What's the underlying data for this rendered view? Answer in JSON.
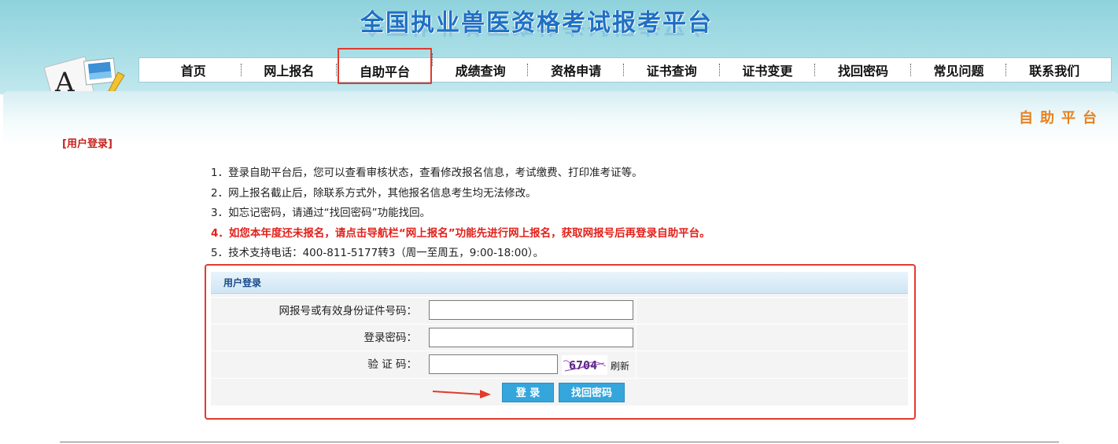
{
  "header": {
    "site_title": "全国执业兽医资格考试报考平台"
  },
  "nav": {
    "items": [
      {
        "label": "首页"
      },
      {
        "label": "网上报名"
      },
      {
        "label": "自助平台",
        "active": true
      },
      {
        "label": "成绩查询"
      },
      {
        "label": "资格申请"
      },
      {
        "label": "证书查询"
      },
      {
        "label": "证书变更"
      },
      {
        "label": "找回密码"
      },
      {
        "label": "常见问题"
      },
      {
        "label": "联系我们"
      }
    ]
  },
  "page": {
    "heading": "自助平台",
    "section_label": "[用户登录]"
  },
  "notes": [
    "1．登录自助平台后，您可以查看审核状态，查看修改报名信息，考试缴费、打印准考证等。",
    "2．网上报名截止后，除联系方式外，其他报名信息考生均无法修改。",
    "3．如忘记密码，请通过“找回密码”功能找回。",
    "4．如您本年度还未报名，请点击导航栏“网上报名”功能先进行网上报名，获取网报号后再登录自助平台。",
    "5．技术支持电话：400-811-5177转3（周一至周五，9:00-18:00）。"
  ],
  "login": {
    "panel_title": "用户登录",
    "id_label": "网报号或有效身份证件号码：",
    "id_value": "",
    "password_label": "登录密码：",
    "password_value": "",
    "captcha_label": "验 证 码：",
    "captcha_value": "",
    "captcha_text": "6704",
    "refresh_label": "刷新",
    "login_button": "登 录",
    "forgot_button": "找回密码"
  },
  "colors": {
    "header_bg": "#a9dee6",
    "title_blue": "#1f6fc4",
    "heading_orange": "#e8811f",
    "highlight_red": "#e3211b",
    "annotation_red": "#e23a2c",
    "button_blue": "#35a6dc"
  }
}
